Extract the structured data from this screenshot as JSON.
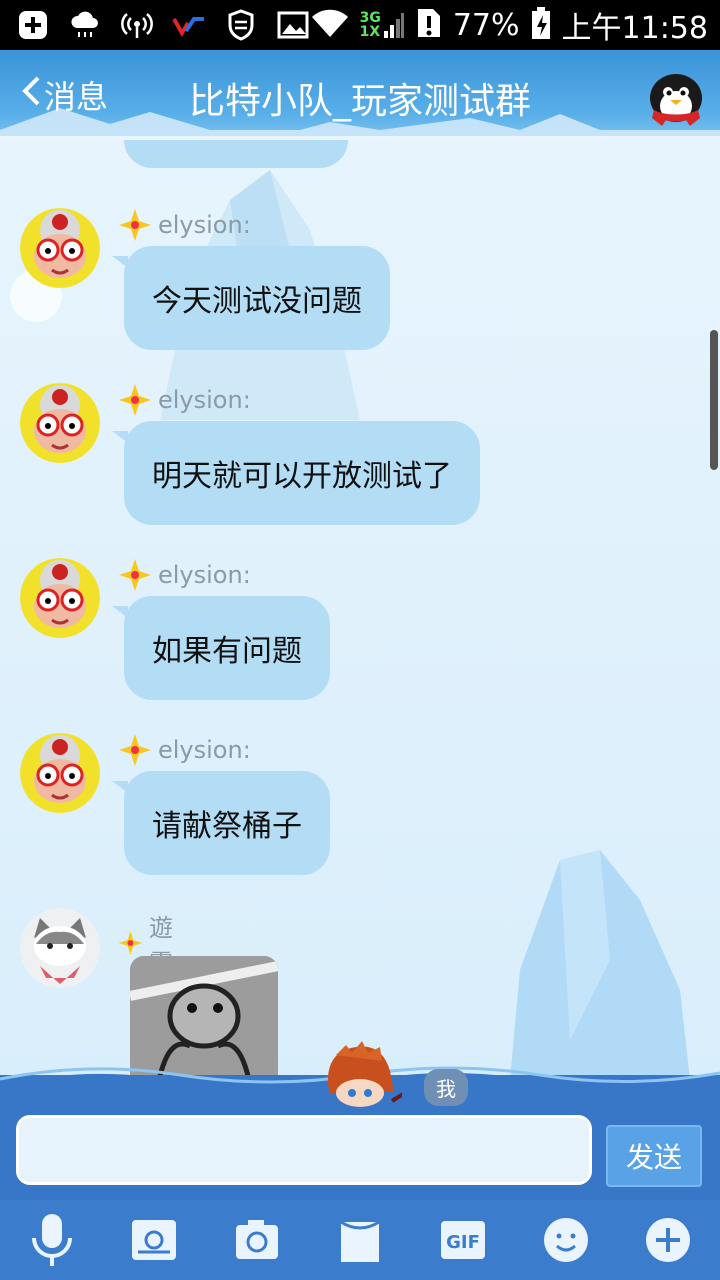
{
  "status_bar": {
    "network_top": "3G",
    "network_bottom": "1X",
    "battery_percent": "77%",
    "time": "上午11:58",
    "icons": [
      "plus-icon",
      "cloud-rain-icon",
      "hotspot-icon",
      "app-logo-icon",
      "shield-icon",
      "image-icon",
      "wifi-icon",
      "signal-icon",
      "sim-alert-icon",
      "battery-charging-icon"
    ]
  },
  "header": {
    "back_label": "消息",
    "title": "比特小队_玩家测试群",
    "right_icon": "penguin-avatar-icon"
  },
  "messages": [
    {
      "sender": "elysion:",
      "text": "今天测试没问题",
      "avatar": "granny-avatar"
    },
    {
      "sender": "elysion:",
      "text": "明天就可以开放测试了",
      "avatar": "granny-avatar"
    },
    {
      "sender": "elysion:",
      "text": "如果有问题",
      "avatar": "granny-avatar"
    },
    {
      "sender": "elysion:",
      "text": "请献祭桶子",
      "avatar": "granny-avatar"
    },
    {
      "sender": "遊靈:",
      "text": "",
      "avatar": "cat-avatar",
      "type": "image"
    }
  ],
  "input": {
    "placeholder": "",
    "send_label": "发送",
    "me_tag": "我"
  },
  "toolbar": {
    "gif_label": "GIF",
    "items": [
      "microphone-icon",
      "image-gallery-icon",
      "camera-icon",
      "folder-icon",
      "gif-icon",
      "emoji-icon",
      "add-icon"
    ]
  },
  "colors": {
    "header": "#3b93d8",
    "bubble": "#b3dcf5",
    "toolbar": "#3c7ccd",
    "chat_bg": "#e7f4fd"
  }
}
